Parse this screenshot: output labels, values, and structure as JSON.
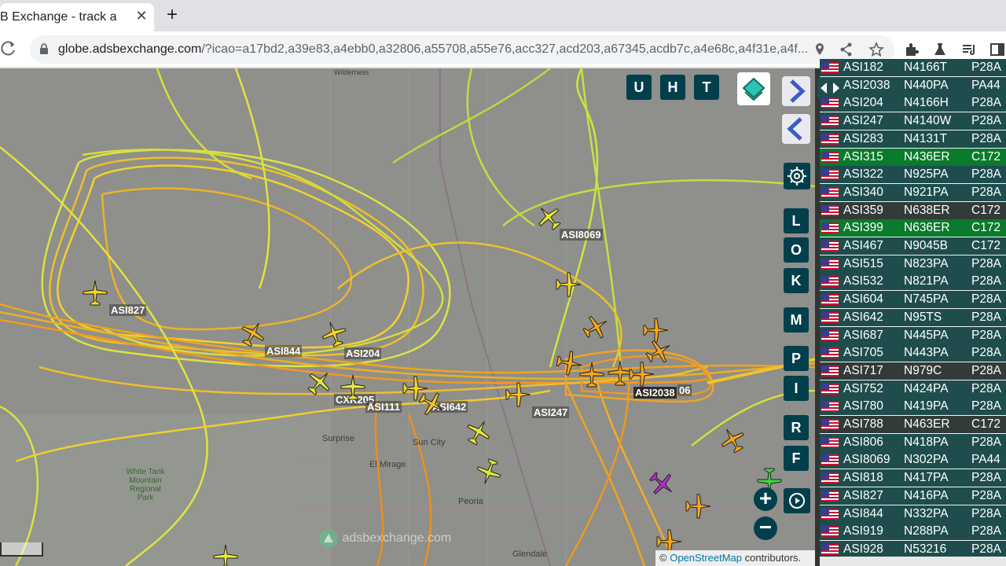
{
  "browser": {
    "tab_title": "B Exchange - track a",
    "close_glyph": "✕",
    "new_tab_glyph": "+",
    "url_host": "globe.adsbexchange.com",
    "url_rest": "/?icao=a17bd2,a39e83,a4ebb0,a32806,a55708,a55e76,acc327,acd203,a67345,acdb7c,a4e68c,a4f31e,a4f..."
  },
  "map": {
    "places": [
      "Surprise",
      "Sun City",
      "El Mirage",
      "Peoria",
      "Glendale",
      "White Tank Mountain Regional Park",
      "Wilderness"
    ],
    "watermark": "adsbexchange.com",
    "attribution_symbol": "©",
    "attribution_link": "OpenStreetMap",
    "attribution_text": " contributors.",
    "plane_labels": [
      "ASI8069",
      "ASI827",
      "ASI844",
      "ASI204",
      "CXK205",
      "ASI111",
      "ASI642",
      "ASI247",
      "ASI2038",
      "06"
    ],
    "top_buttons": [
      "U",
      "H",
      "T"
    ],
    "side_buttons": [
      "L",
      "O",
      "K",
      "M",
      "P",
      "I",
      "R",
      "F"
    ],
    "zoom_in": "+",
    "zoom_out": "−"
  },
  "sidebar": {
    "rows": [
      {
        "callsign": "ASI182",
        "reg": "N4166T",
        "type": "P28A",
        "style": "teal"
      },
      {
        "callsign": "ASI2038",
        "reg": "N440PA",
        "type": "PA44",
        "style": "teal"
      },
      {
        "callsign": "ASI204",
        "reg": "N4166H",
        "type": "P28A",
        "style": "teal"
      },
      {
        "callsign": "ASI247",
        "reg": "N4140W",
        "type": "P28A",
        "style": "teal"
      },
      {
        "callsign": "ASI283",
        "reg": "N4131T",
        "type": "P28A",
        "style": "teal"
      },
      {
        "callsign": "ASI315",
        "reg": "N436ER",
        "type": "C172",
        "style": "green"
      },
      {
        "callsign": "ASI322",
        "reg": "N925PA",
        "type": "P28A",
        "style": "teal"
      },
      {
        "callsign": "ASI340",
        "reg": "N921PA",
        "type": "P28A",
        "style": "teal"
      },
      {
        "callsign": "ASI359",
        "reg": "N638ER",
        "type": "C172",
        "style": "dark"
      },
      {
        "callsign": "ASI399",
        "reg": "N636ER",
        "type": "C172",
        "style": "green"
      },
      {
        "callsign": "ASI467",
        "reg": "N9045B",
        "type": "C172",
        "style": "teal"
      },
      {
        "callsign": "ASI515",
        "reg": "N823PA",
        "type": "P28A",
        "style": "teal"
      },
      {
        "callsign": "ASI532",
        "reg": "N821PA",
        "type": "P28A",
        "style": "teal"
      },
      {
        "callsign": "ASI604",
        "reg": "N745PA",
        "type": "P28A",
        "style": "teal"
      },
      {
        "callsign": "ASI642",
        "reg": "N95TS",
        "type": "P28A",
        "style": "teal"
      },
      {
        "callsign": "ASI687",
        "reg": "N445PA",
        "type": "P28A",
        "style": "teal"
      },
      {
        "callsign": "ASI705",
        "reg": "N443PA",
        "type": "P28A",
        "style": "teal"
      },
      {
        "callsign": "ASI717",
        "reg": "N979C",
        "type": "P28A",
        "style": "dark"
      },
      {
        "callsign": "ASI752",
        "reg": "N424PA",
        "type": "P28A",
        "style": "teal"
      },
      {
        "callsign": "ASI780",
        "reg": "N419PA",
        "type": "P28A",
        "style": "teal"
      },
      {
        "callsign": "ASI788",
        "reg": "N463ER",
        "type": "C172",
        "style": "dark"
      },
      {
        "callsign": "ASI806",
        "reg": "N418PA",
        "type": "P28A",
        "style": "teal"
      },
      {
        "callsign": "ASI8069",
        "reg": "N302PA",
        "type": "PA44",
        "style": "teal"
      },
      {
        "callsign": "ASI818",
        "reg": "N417PA",
        "type": "P28A",
        "style": "teal"
      },
      {
        "callsign": "ASI827",
        "reg": "N416PA",
        "type": "P28A",
        "style": "teal"
      },
      {
        "callsign": "ASI844",
        "reg": "N332PA",
        "type": "P28A",
        "style": "teal"
      },
      {
        "callsign": "ASI919",
        "reg": "N288PA",
        "type": "P28A",
        "style": "teal"
      },
      {
        "callsign": "ASI928",
        "reg": "N53216",
        "type": "P28A",
        "style": "teal"
      }
    ]
  },
  "colors": {
    "accent": "#003f4b",
    "row_teal": "#1f4d4d",
    "row_green": "#0a7a2c",
    "track_yellow": "#e8e83a",
    "track_orange": "#f5a31a"
  }
}
